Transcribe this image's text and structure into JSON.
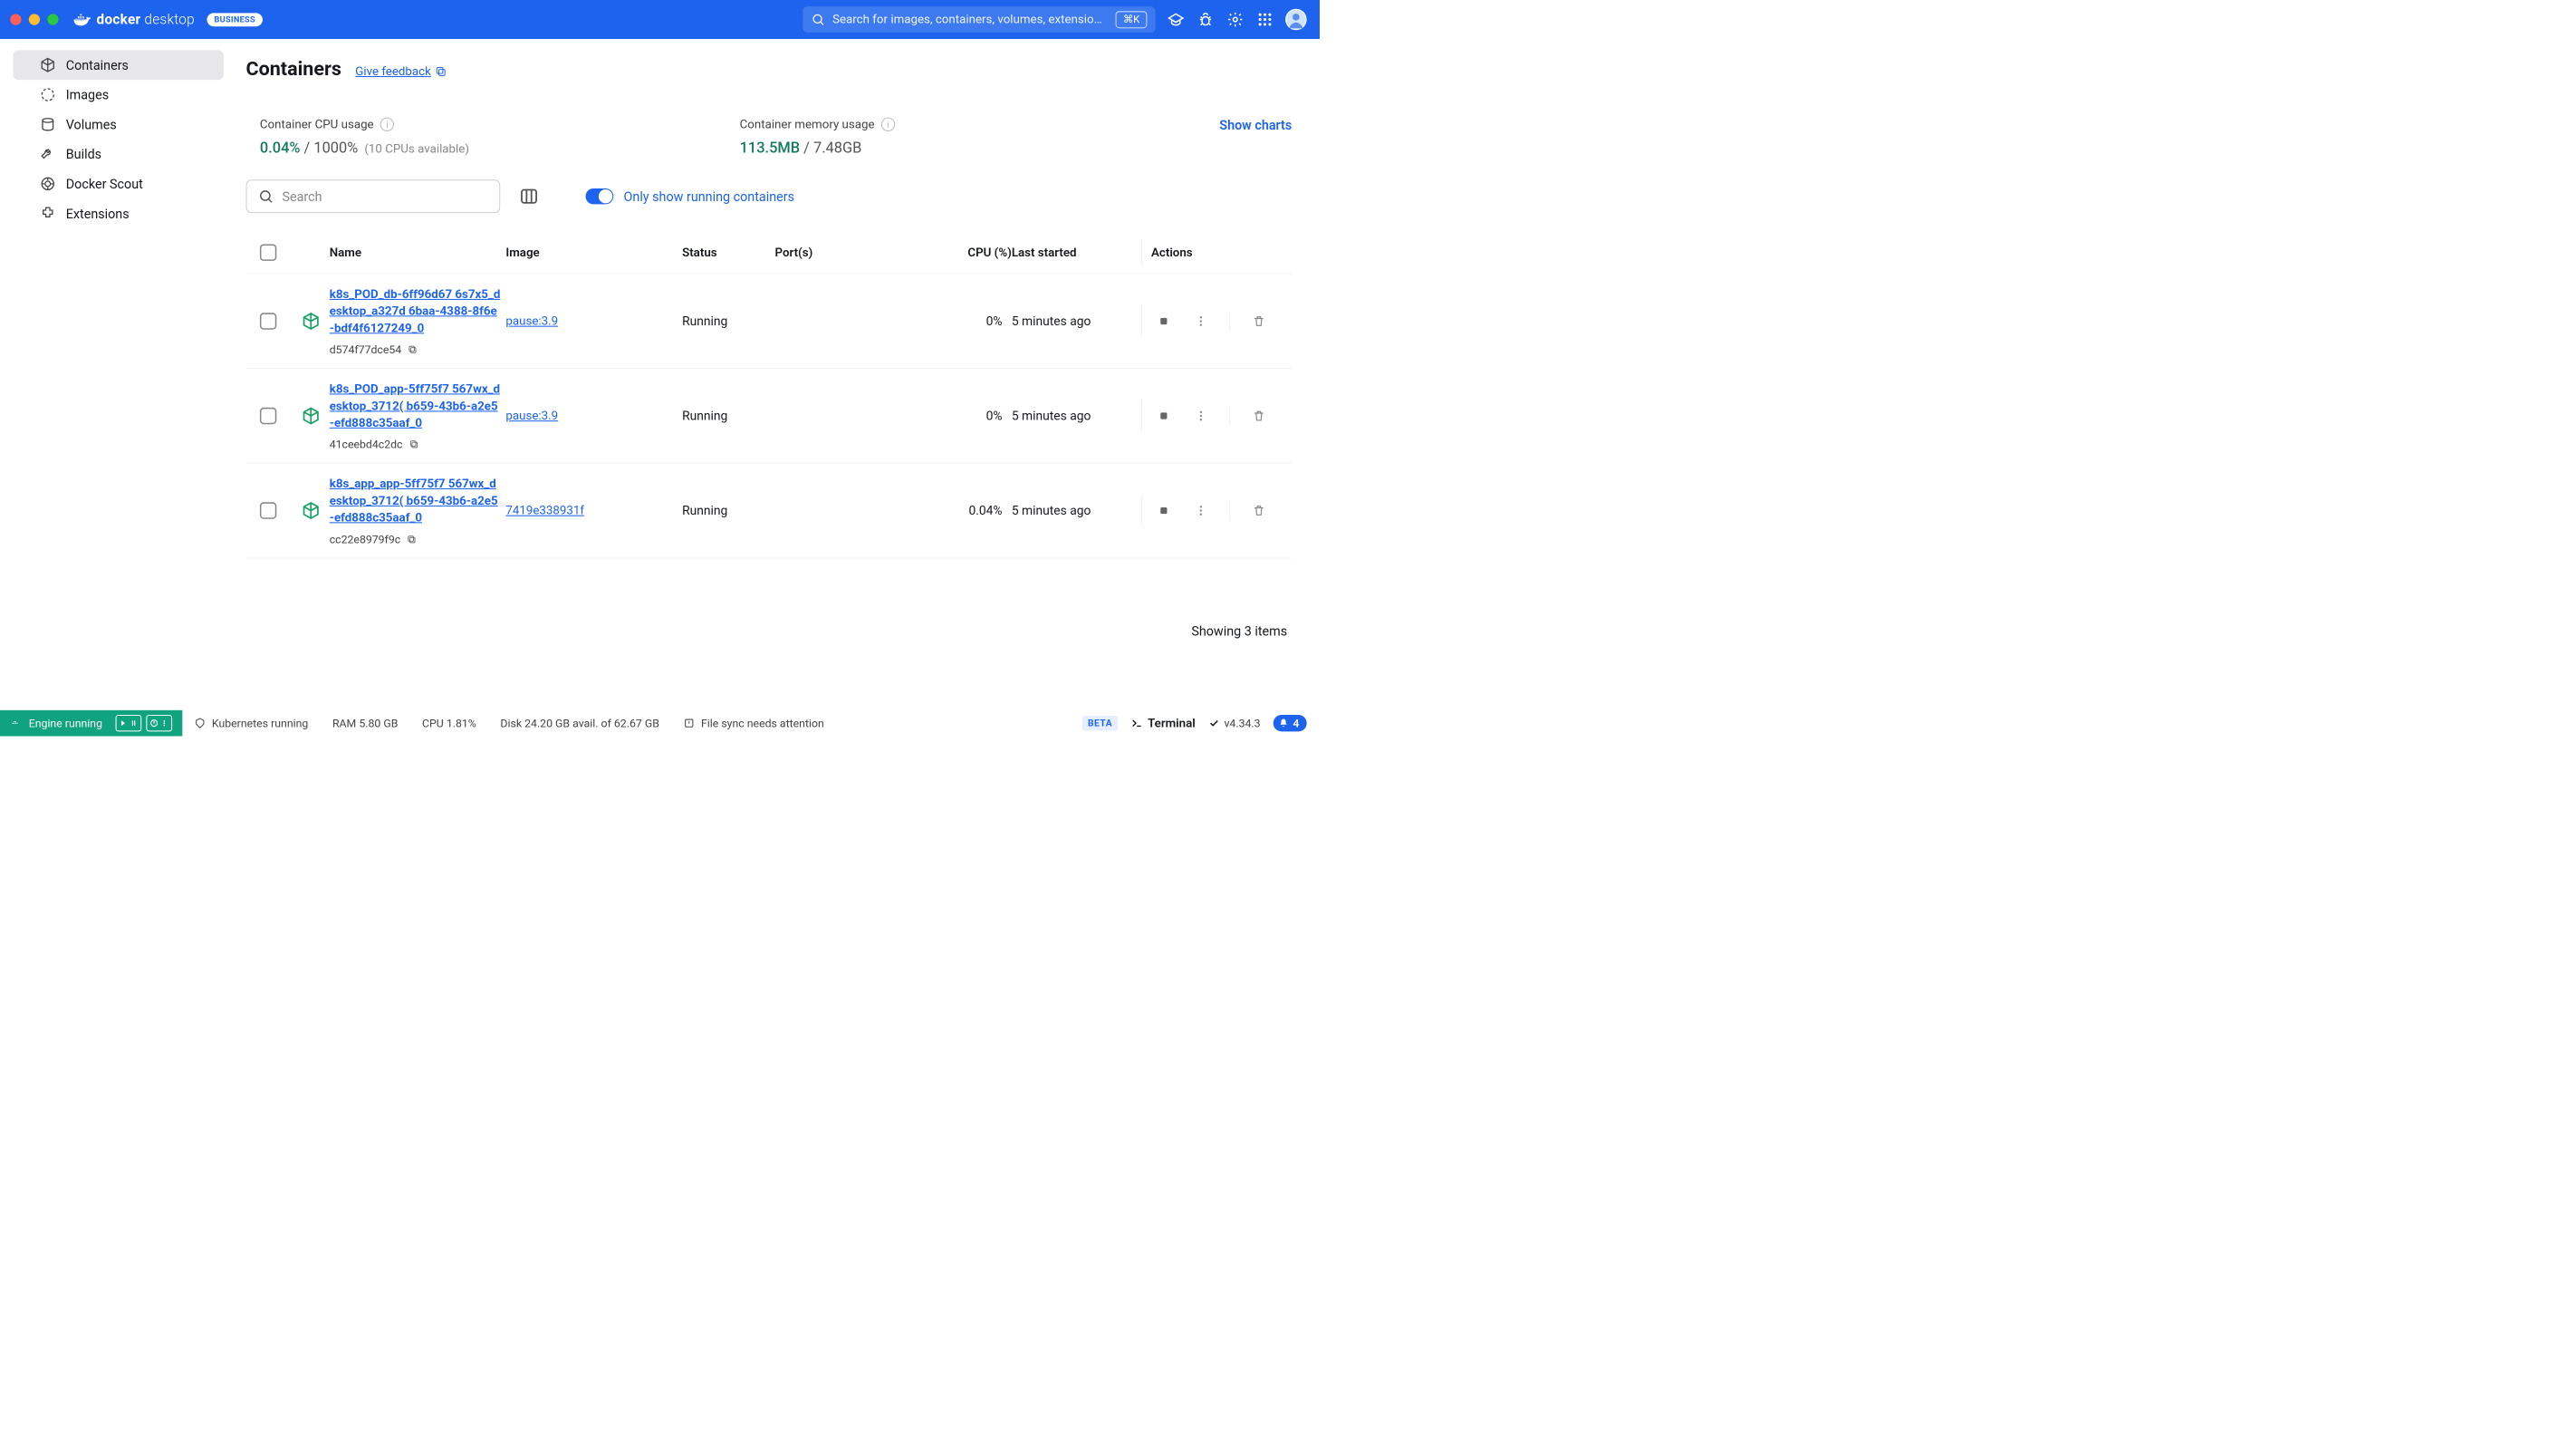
{
  "brand": {
    "name_bold": "docker",
    "name_light": " desktop",
    "badge": "BUSINESS"
  },
  "header": {
    "search_placeholder": "Search for images, containers, volumes, extensio…",
    "shortcut": "⌘K"
  },
  "sidebar": {
    "items": [
      {
        "label": "Containers"
      },
      {
        "label": "Images"
      },
      {
        "label": "Volumes"
      },
      {
        "label": "Builds"
      },
      {
        "label": "Docker Scout"
      },
      {
        "label": "Extensions"
      }
    ]
  },
  "page": {
    "title": "Containers",
    "feedback": "Give feedback"
  },
  "stats": {
    "cpu": {
      "label": "Container CPU usage",
      "used": "0.04%",
      "sep": " / ",
      "total": "1000%",
      "note": "(10 CPUs available)"
    },
    "mem": {
      "label": "Container memory usage",
      "used": "113.5MB",
      "sep": " / ",
      "total": "7.48GB"
    },
    "show_charts": "Show charts"
  },
  "toolbar": {
    "search_placeholder": "Search",
    "toggle_label": "Only show running containers"
  },
  "table": {
    "headers": {
      "name": "Name",
      "image": "Image",
      "status": "Status",
      "ports": "Port(s)",
      "cpu": "CPU (%)",
      "started": "Last started",
      "actions": "Actions"
    },
    "rows": [
      {
        "name": "k8s_POD_db-6ff96d67 6s7x5_desktop_a327d 6baa-4388-8f6e-bdf4f6127249_0",
        "hash": "d574f77dce54",
        "image": "pause:3.9",
        "status": "Running",
        "ports": "",
        "cpu": "0%",
        "started": "5 minutes ago"
      },
      {
        "name": "k8s_POD_app-5ff75f7 567wx_desktop_3712( b659-43b6-a2e5-efd888c35aaf_0",
        "hash": "41ceebd4c2dc",
        "image": "pause:3.9",
        "status": "Running",
        "ports": "",
        "cpu": "0%",
        "started": "5 minutes ago"
      },
      {
        "name": "k8s_app_app-5ff75f7 567wx_desktop_3712( b659-43b6-a2e5-efd888c35aaf_0",
        "hash": "cc22e8979f9c",
        "image": "7419e338931f",
        "status": "Running",
        "ports": "",
        "cpu": "0.04%",
        "started": "5 minutes ago"
      }
    ],
    "footer": "Showing 3 items"
  },
  "statusbar": {
    "engine": "Engine running",
    "k8s": "Kubernetes running",
    "ram": "RAM 5.80 GB",
    "cpu": "CPU 1.81%",
    "disk": "Disk 24.20 GB avail. of 62.67 GB",
    "sync": "File sync needs attention",
    "beta": "BETA",
    "terminal": "Terminal",
    "version": "v4.34.3",
    "notif_count": "4"
  }
}
